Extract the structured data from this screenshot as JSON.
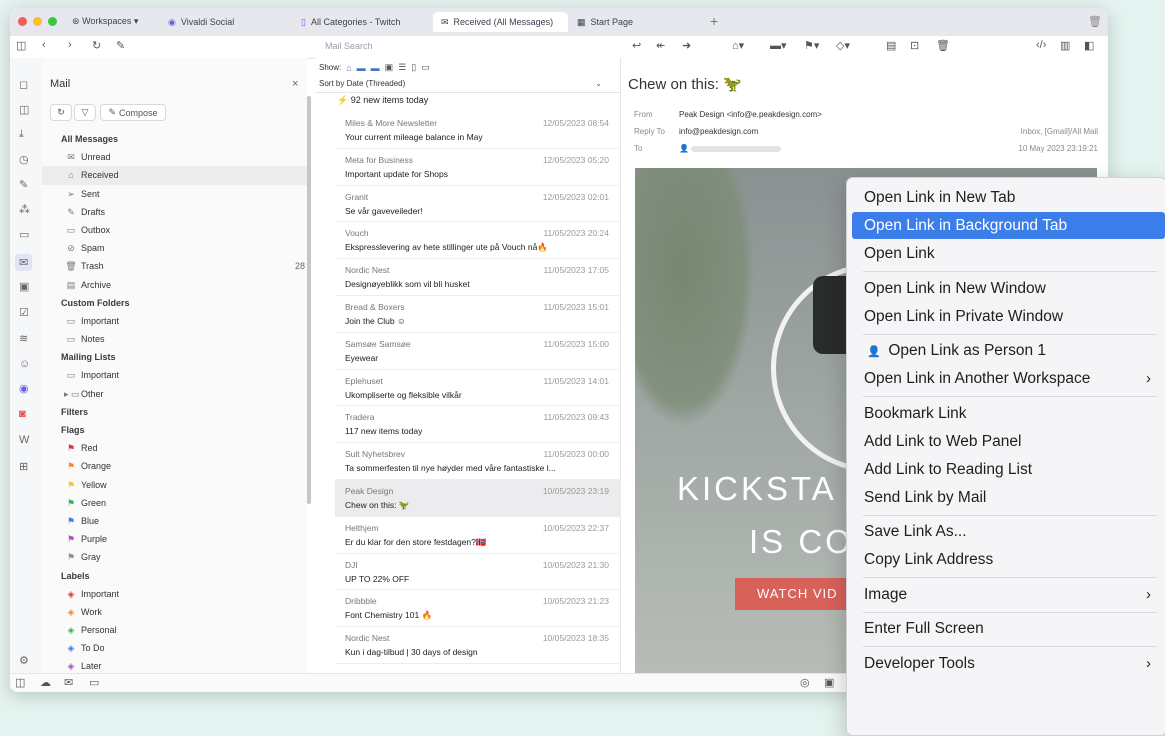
{
  "tabs": {
    "workspaces": "Workspaces",
    "items": [
      {
        "label": "Vivaldi Social"
      },
      {
        "label": "All Categories - Twitch"
      },
      {
        "label": "Received (All Messages)"
      },
      {
        "label": "Start Page"
      }
    ],
    "plus": "+"
  },
  "toolbar": {
    "search_placeholder": "Mail Search"
  },
  "sidebar": {
    "title": "Mail",
    "close": "×",
    "compose": "Compose",
    "tree": [
      {
        "label": "All Messages",
        "type": "header"
      },
      {
        "label": "Unread",
        "icon": "✉",
        "indent": 1
      },
      {
        "label": "Received",
        "icon": "⌂",
        "indent": 1,
        "selected": true
      },
      {
        "label": "Sent",
        "icon": "➢",
        "indent": 1
      },
      {
        "label": "Drafts",
        "icon": "✎",
        "indent": 1
      },
      {
        "label": "Outbox",
        "icon": "▭",
        "indent": 1
      },
      {
        "label": "Spam",
        "icon": "⊘",
        "indent": 1
      },
      {
        "label": "Trash",
        "icon": "🗑",
        "indent": 1,
        "count": "28"
      },
      {
        "label": "Archive",
        "icon": "▤",
        "indent": 1
      },
      {
        "label": "Custom Folders",
        "type": "header"
      },
      {
        "label": "Important",
        "icon": "▭",
        "indent": 1
      },
      {
        "label": "Notes",
        "icon": "▭",
        "indent": 1
      },
      {
        "label": "Mailing Lists",
        "type": "header"
      },
      {
        "label": "Important",
        "icon": "▭",
        "indent": 1
      },
      {
        "label": "Other",
        "icon": "▸ ▭",
        "indent": 1
      },
      {
        "label": "Filters",
        "type": "header"
      },
      {
        "label": "Flags",
        "type": "header"
      },
      {
        "label": "Red",
        "icon": "⚑",
        "color": "#d9363e",
        "indent": 1
      },
      {
        "label": "Orange",
        "icon": "⚑",
        "color": "#ee8a2a",
        "indent": 1
      },
      {
        "label": "Yellow",
        "icon": "⚑",
        "color": "#e9c630",
        "indent": 1
      },
      {
        "label": "Green",
        "icon": "⚑",
        "color": "#3aae5a",
        "indent": 1
      },
      {
        "label": "Blue",
        "icon": "⚑",
        "color": "#3b7de9",
        "indent": 1
      },
      {
        "label": "Purple",
        "icon": "⚑",
        "color": "#b048c8",
        "indent": 1
      },
      {
        "label": "Gray",
        "icon": "⚑",
        "color": "#8c8c8c",
        "indent": 1
      },
      {
        "label": "Labels",
        "type": "header"
      },
      {
        "label": "Important",
        "icon": "◈",
        "color": "#d9363e",
        "indent": 1
      },
      {
        "label": "Work",
        "icon": "◈",
        "color": "#ee8a2a",
        "indent": 1
      },
      {
        "label": "Personal",
        "icon": "◈",
        "color": "#3aae5a",
        "indent": 1
      },
      {
        "label": "To Do",
        "icon": "◈",
        "color": "#3b7de9",
        "indent": 1
      },
      {
        "label": "Later",
        "icon": "◈",
        "color": "#b048c8",
        "indent": 1
      }
    ]
  },
  "list": {
    "show_label": "Show:",
    "sort_label": "Sort by Date (Threaded)",
    "first_subject": "92 new items today",
    "messages": [
      {
        "from": "Miles & More Newsletter",
        "date": "12/05/2023 08:54",
        "subject": "Your current mileage balance in May"
      },
      {
        "from": "Meta for Business",
        "date": "12/05/2023 05:20",
        "subject": "Important update for Shops"
      },
      {
        "from": "Granit",
        "date": "12/05/2023 02:01",
        "subject": "Se vår gaveveileder!"
      },
      {
        "from": "Vouch",
        "date": "11/05/2023 20:24",
        "subject": "Ekspresslevering av hete stillinger ute på Vouch nå🔥"
      },
      {
        "from": "Nordic Nest",
        "date": "11/05/2023 17:05",
        "subject": "Designøyeblikk som vil bli husket"
      },
      {
        "from": "Bread & Boxers",
        "date": "11/05/2023 15:01",
        "subject": "Join the Club ☺"
      },
      {
        "from": "Samsøe Samsøe",
        "date": "11/05/2023 15:00",
        "subject": "Eyewear"
      },
      {
        "from": "Eplehuset",
        "date": "11/05/2023 14:01",
        "subject": "Ukompliserte og fleksible vilkår"
      },
      {
        "from": "Tradera",
        "date": "11/05/2023 09:43",
        "subject": "117 new items today"
      },
      {
        "from": "Sult Nyhetsbrev",
        "date": "11/05/2023 00:00",
        "subject": "Ta sommerfesten til nye høyder med våre fantastiske l..."
      },
      {
        "from": "Peak Design",
        "date": "10/05/2023 23:19",
        "subject": "Chew on this: 🦖",
        "selected": true
      },
      {
        "from": "Helthjem",
        "date": "10/05/2023 22:37",
        "subject": "Er du klar for den store festdagen?🇳🇴"
      },
      {
        "from": "DJI",
        "date": "10/05/2023 21:30",
        "subject": "UP TO 22% OFF"
      },
      {
        "from": "Dribbble",
        "date": "10/05/2023 21:23",
        "subject": "Font Chemistry 101 🔥"
      },
      {
        "from": "Nordic Nest",
        "date": "10/05/2023 18:35",
        "subject": "Kun i dag-tilbud | 30 days of design"
      }
    ]
  },
  "preview": {
    "subject": "Chew on this: 🦖",
    "from_label": "From",
    "from_value": "Peak Design <info@e.peakdesign.com>",
    "replyto_label": "Reply To",
    "replyto_value": "info@peakdesign.com",
    "to_label": "To",
    "to_value": "",
    "folder": "Inbox, [Gmail]/All Mail",
    "date": "10 May 2023 23:19:21",
    "hero_line1": "KICKSTA",
    "hero_line2": "IS CO",
    "watch_label": "WATCH VID"
  },
  "context_menu": {
    "items": [
      {
        "label": "Open Link in New Tab"
      },
      {
        "label": "Open Link in Background Tab",
        "highlight": true
      },
      {
        "label": "Open Link"
      },
      {
        "separator": true
      },
      {
        "label": "Open Link in New Window"
      },
      {
        "label": "Open Link in Private Window"
      },
      {
        "separator": true
      },
      {
        "label": "Open Link as Person 1",
        "person": true
      },
      {
        "label": "Open Link in Another Workspace",
        "submenu": true
      },
      {
        "separator": true
      },
      {
        "label": "Bookmark Link"
      },
      {
        "label": "Add Link to Web Panel"
      },
      {
        "label": "Add Link to Reading List"
      },
      {
        "label": "Send Link by Mail"
      },
      {
        "separator": true
      },
      {
        "label": "Save Link As..."
      },
      {
        "label": "Copy Link Address"
      },
      {
        "separator": true
      },
      {
        "label": "Image",
        "submenu": true
      },
      {
        "separator": true
      },
      {
        "label": "Enter Full Screen"
      },
      {
        "separator": true
      },
      {
        "label": "Developer Tools",
        "submenu": true
      }
    ]
  }
}
